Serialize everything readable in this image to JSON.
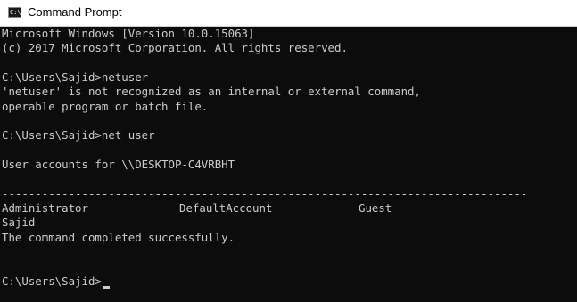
{
  "window": {
    "title": "Command Prompt",
    "icon": "cmd-icon",
    "icon_glyph": "C:\\"
  },
  "console": {
    "lines": [
      "Microsoft Windows [Version 10.0.15063]",
      "(c) 2017 Microsoft Corporation. All rights reserved.",
      "",
      "C:\\Users\\Sajid>netuser",
      "'netuser' is not recognized as an internal or external command,",
      "operable program or batch file.",
      "",
      "C:\\Users\\Sajid>net user",
      "",
      "User accounts for \\\\DESKTOP-C4VRBHT",
      "",
      "-------------------------------------------------------------------------------"
    ],
    "accounts": [
      "Administrator",
      "DefaultAccount",
      "Guest",
      "Sajid"
    ],
    "completion": "The command completed successfully.",
    "prompt": "C:\\Users\\Sajid>"
  },
  "colors": {
    "background": "#0c0c0c",
    "text": "#cccccc"
  }
}
